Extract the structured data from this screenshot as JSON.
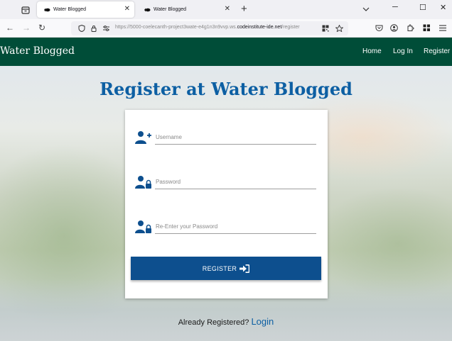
{
  "browser": {
    "tabs": [
      {
        "title": "Water Blogged",
        "active": true
      },
      {
        "title": "Water Blogged",
        "active": false
      }
    ],
    "url_prefix": "https://5000-coelecanth-project3wate-e4g1n3n9vvp.ws.",
    "url_host": "codeinstitute-ide.net",
    "url_path": "/register",
    "icons": {
      "tab_list": "tab-list-icon",
      "new_tab": "+",
      "tabs_menu": "chevron-down-icon",
      "minimize": "─",
      "maximize": "☐",
      "close": "✕",
      "back": "←",
      "forward": "→",
      "reload": "↻"
    }
  },
  "site": {
    "brand": "Water Blogged",
    "nav": [
      {
        "label": "Home"
      },
      {
        "label": "Log In"
      },
      {
        "label": "Register"
      }
    ],
    "header_color": "#004d38"
  },
  "register": {
    "title": "Register at Water Blogged",
    "username_placeholder": "Username",
    "password_placeholder": "Password",
    "confirm_placeholder": "Re-Enter your Password",
    "button_label": "REGISTER",
    "already_text": "Already Registered?",
    "login_link": "Login",
    "accent_color": "#0d4f8e",
    "title_color": "#0d5fa3"
  }
}
